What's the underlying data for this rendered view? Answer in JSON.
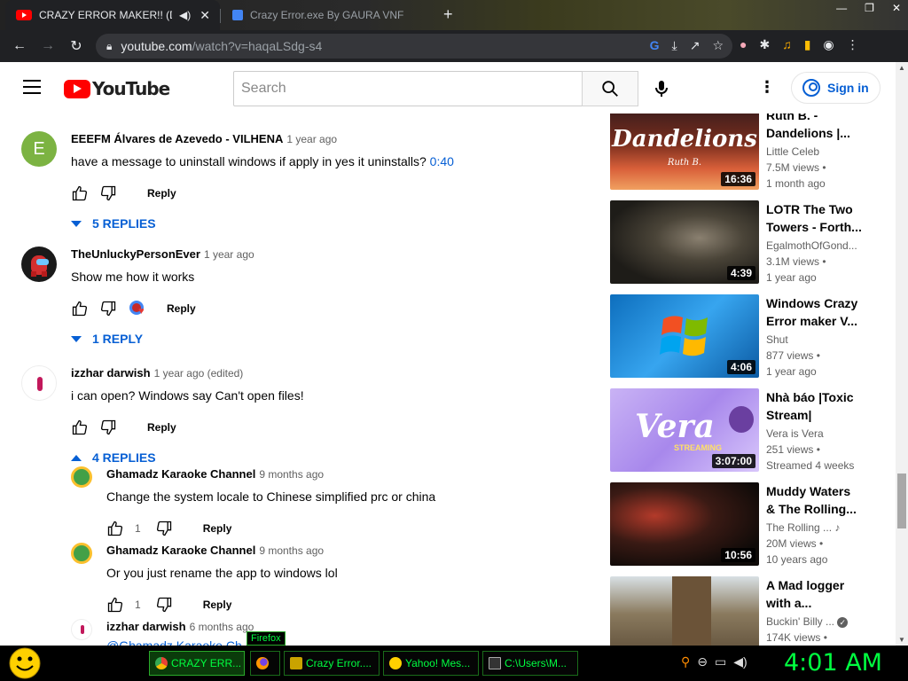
{
  "browser": {
    "tabs": [
      {
        "title": "CRAZY ERROR MAKER!! (DO",
        "active": true
      },
      {
        "title": "Crazy Error.exe By GAURA VNF",
        "active": false
      }
    ],
    "url_host": "youtube.com",
    "url_path": "/watch?v=haqaLSdg-s4"
  },
  "youtube": {
    "logo_text": "YouTube",
    "search_placeholder": "Search",
    "signin_label": "Sign in"
  },
  "comments": [
    {
      "author": "EEEFM Álvares de Azevedo - VILHENA",
      "time": "1 year ago",
      "text": "have a message to uninstall windows if apply in yes it uninstalls?",
      "timestamp_link": "0:40",
      "avatar_letter": "E",
      "avatar_color": "#7cb342",
      "reply_label": "Reply",
      "replies_label": "5 REPLIES"
    },
    {
      "author": "TheUnluckyPersonEver",
      "time": "1 year ago",
      "text": "Show me how it works",
      "reply_label": "Reply",
      "replies_label": "1 REPLY"
    },
    {
      "author": "izzhar darwish",
      "time": "1 year ago (edited)",
      "text": "i can open? Windows say Can't open files!",
      "reply_label": "Reply",
      "replies_label": "4 REPLIES"
    }
  ],
  "replies": [
    {
      "author": "Ghamadz Karaoke Channel",
      "time": "9 months ago",
      "text": "Change the system locale to Chinese simplified prc or china",
      "likes": "1",
      "reply_label": "Reply"
    },
    {
      "author": "Ghamadz Karaoke Channel",
      "time": "9 months ago",
      "text": "Or you just rename the app to windows lol",
      "likes": "1",
      "reply_label": "Reply"
    },
    {
      "author": "izzhar darwish",
      "time": "6 months ago",
      "text": "@Ghamadz Karaoke Ch..."
    }
  ],
  "sidebar": [
    {
      "title": "Ruth B. - Dandelions |...",
      "channel": "Little Celeb",
      "views": "7.5M views •",
      "age": "1 month ago",
      "duration": "16:36",
      "thumb_text": "Dandelions",
      "thumb_sub": "Ruth B."
    },
    {
      "title": "LOTR The Two Towers - Forth...",
      "channel": "EgalmothOfGond...",
      "views": "3.1M views •",
      "age": "1 year ago",
      "duration": "4:39"
    },
    {
      "title": "Windows Crazy Error maker V...",
      "channel": "Shut",
      "views": "877 views •",
      "age": "1 year ago",
      "duration": "4:06"
    },
    {
      "title": "Nhà báo |Toxic Stream|",
      "channel": "Vera is Vera",
      "views": "251 views •",
      "age": "Streamed 4 weeks",
      "duration": "3:07:00",
      "thumb_text": "Vera",
      "thumb_sub": "STREAMING"
    },
    {
      "title": "Muddy Waters & The Rolling...",
      "channel": "The Rolling ...",
      "views": "20M views •",
      "age": "10 years ago",
      "duration": "10:56"
    },
    {
      "title": "A Mad logger with a...",
      "channel": "Buckin' Billy ...",
      "views": "174K views •",
      "age": "",
      "duration": ""
    }
  ],
  "taskbar": {
    "tasks": [
      "CRAZY ERR...",
      "",
      "Crazy Error....",
      "Yahoo! Mes...",
      "C:\\Users\\M..."
    ],
    "tooltip": "Firefox",
    "clock": "4:01 AM"
  }
}
